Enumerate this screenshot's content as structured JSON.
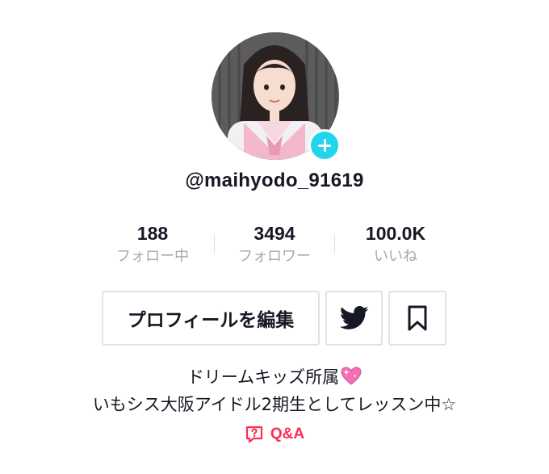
{
  "profile": {
    "username": "@maihyodo_91619",
    "avatar_icon": "avatar-photo",
    "follow_icon": "plus-icon"
  },
  "stats": [
    {
      "value": "188",
      "label": "フォロー中"
    },
    {
      "value": "3494",
      "label": "フォロワー"
    },
    {
      "value": "100.0K",
      "label": "いいね"
    }
  ],
  "actions": {
    "edit_profile_label": "プロフィールを編集",
    "twitter_icon": "twitter-bird-icon",
    "bookmark_icon": "bookmark-icon"
  },
  "bio": {
    "line1": "ドリームキッズ所属",
    "line1_emoji": "sparkling-heart-icon",
    "line2": "いもシス大阪アイドル2期生としてレッスン中☆"
  },
  "qa": {
    "label": "Q&A",
    "icon": "question-bubble-icon"
  },
  "colors": {
    "accent": "#fe2c55",
    "follow_badge": "#20d5ec",
    "muted_text": "#a7a8ad",
    "border": "#e3e3e4"
  }
}
